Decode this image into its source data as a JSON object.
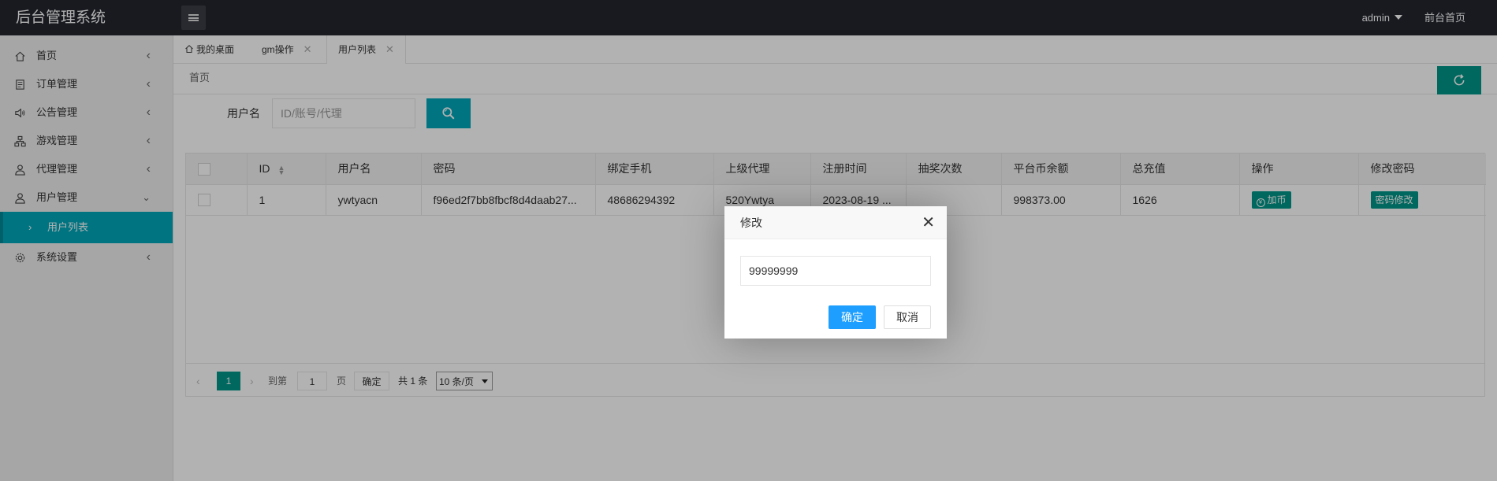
{
  "header": {
    "app_title": "后台管理系统",
    "user_name": "admin",
    "front_link": "前台首页"
  },
  "sidebar": {
    "items": [
      {
        "label": "首页",
        "icon": "home-icon"
      },
      {
        "label": "订单管理",
        "icon": "document-icon"
      },
      {
        "label": "公告管理",
        "icon": "speaker-icon"
      },
      {
        "label": "游戏管理",
        "icon": "sitemap-icon"
      },
      {
        "label": "代理管理",
        "icon": "user-icon"
      },
      {
        "label": "用户管理",
        "icon": "user-icon"
      }
    ],
    "sub_item": {
      "label": "用户列表"
    },
    "settings": {
      "label": "系统设置",
      "icon": "gear-icon"
    }
  },
  "tabs": [
    {
      "label": "我的桌面"
    },
    {
      "label": "gm操作"
    },
    {
      "label": "用户列表"
    }
  ],
  "breadcrumb": "首页",
  "search": {
    "label": "用户名",
    "placeholder": "ID/账号/代理"
  },
  "table": {
    "columns": [
      "ID",
      "用户名",
      "密码",
      "绑定手机",
      "上级代理",
      "注册时间",
      "抽奖次数",
      "平台币余额",
      "总充值",
      "操作",
      "修改密码"
    ],
    "rows": [
      {
        "id": "1",
        "username": "ywtyacn",
        "password": "f96ed2f7bb8fbcf8d4daab27...",
        "phone": "48686294392",
        "agent": "520Ywtya",
        "reg_time": "2023-08-19 ...",
        "lottery": "",
        "balance": "998373.00",
        "recharge": "1626",
        "action_label": "加币",
        "pwd_label": "密码修改"
      }
    ]
  },
  "pager": {
    "current_page": "1",
    "goto_label": "到第",
    "page_input": "1",
    "page_unit": "页",
    "confirm_label": "确定",
    "total_label": "共 1 条",
    "page_size": "10 条/页"
  },
  "modal": {
    "title": "修改",
    "input_value": "99999999",
    "ok_label": "确定",
    "cancel_label": "取消"
  },
  "colors": {
    "header_bg": "#23262e",
    "accent_teal": "#009688",
    "active_cyan": "#00a7b9",
    "modal_primary": "#1e9fff"
  }
}
